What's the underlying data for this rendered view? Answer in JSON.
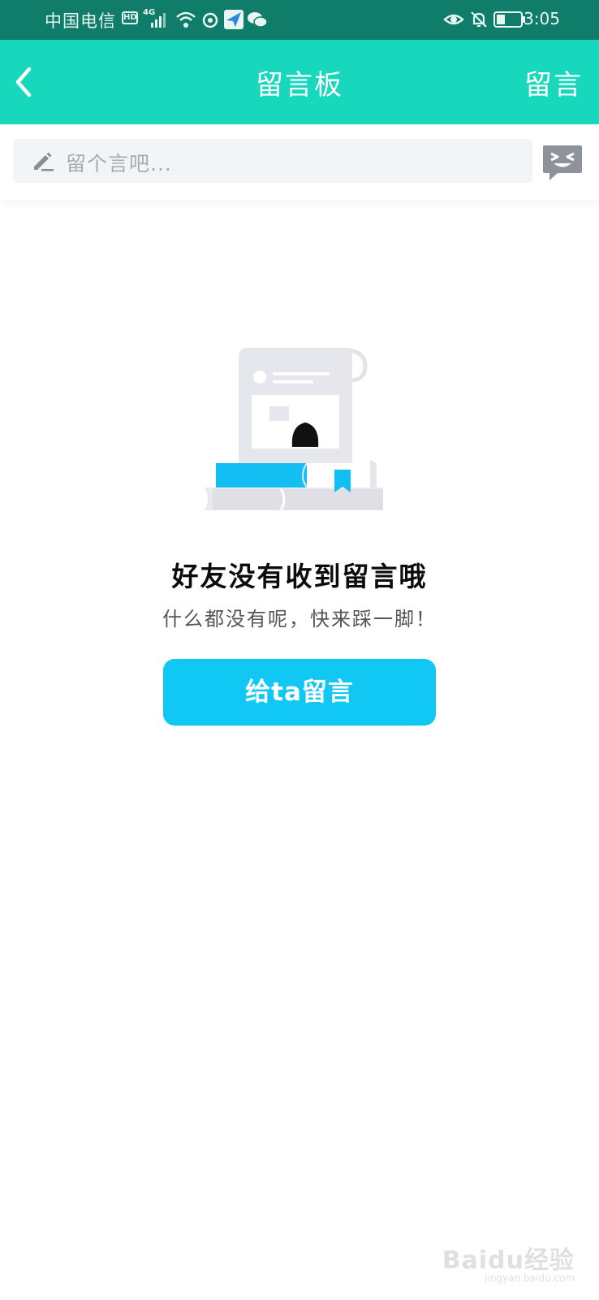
{
  "status_bar": {
    "carrier": "中国电信",
    "hd_label": "HD",
    "network": "4G",
    "time": "3:05"
  },
  "header": {
    "title": "留言板",
    "action_label": "留言"
  },
  "composer": {
    "placeholder": "留个言吧..."
  },
  "empty_state": {
    "title": "好友没有收到留言哦",
    "subtitle": "什么都没有呢，快来踩一脚！",
    "button_label": "给ta留言"
  },
  "watermark": {
    "text": "Baidu经验",
    "url": "jingyan.baidu.com"
  },
  "colors": {
    "status_bar": "#0f7d6a",
    "header": "#17d7bc",
    "button": "#11c8f4",
    "input_bg": "#f3f4f8"
  },
  "icons": [
    "hd-icon",
    "signal-icon",
    "wifi-icon",
    "sync-icon",
    "send-app-icon",
    "wechat-icon",
    "eye-icon",
    "bell-off-icon",
    "battery-icon",
    "back-chevron-icon",
    "pencil-icon",
    "emoji-message-icon",
    "empty-illustration"
  ]
}
